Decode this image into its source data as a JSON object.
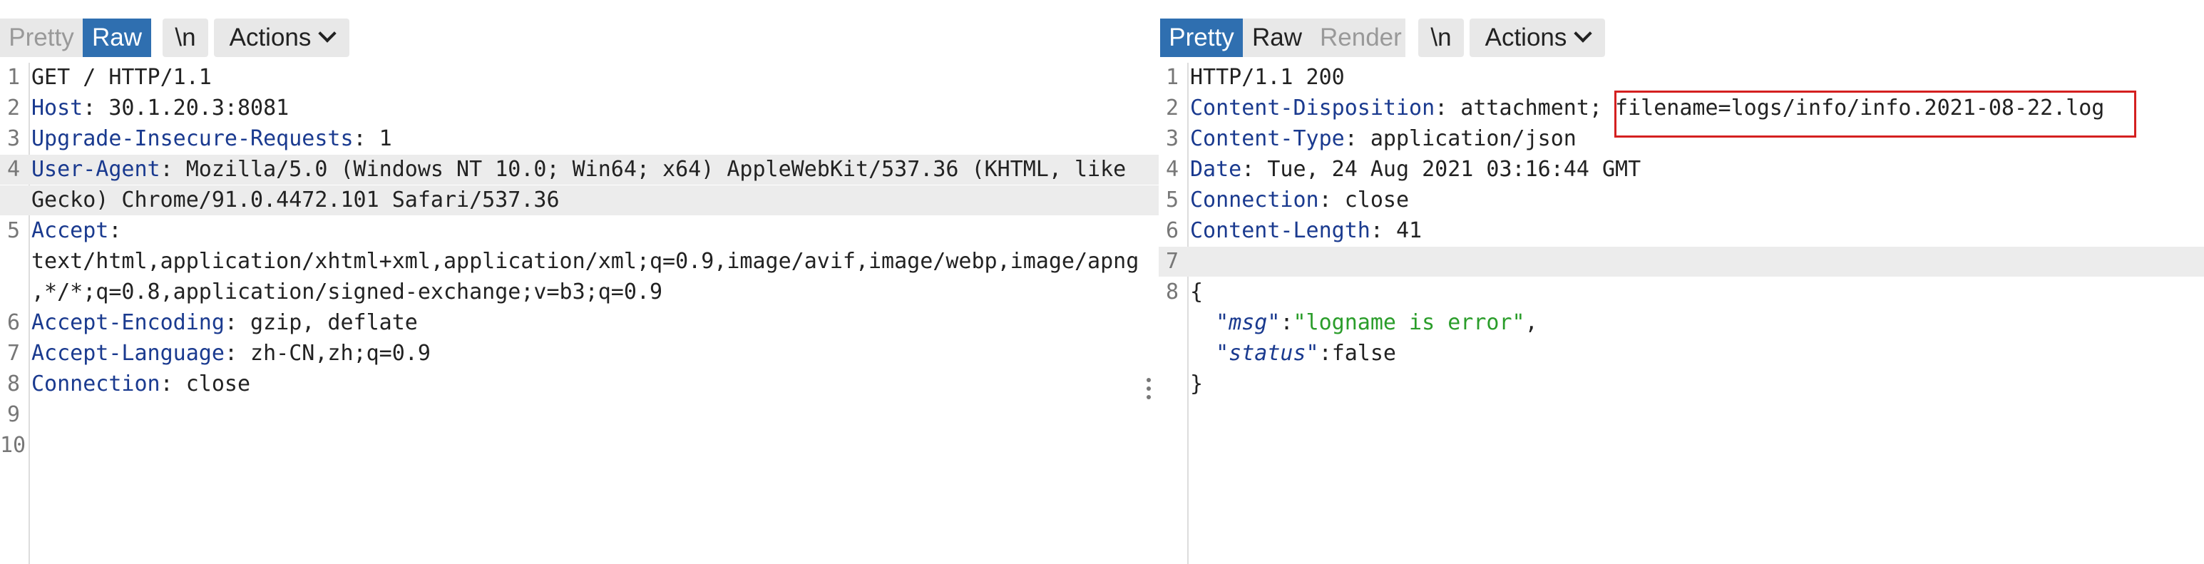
{
  "request": {
    "tabs": [
      {
        "label": "Pretty"
      },
      {
        "label": "Raw",
        "active": true
      },
      {
        "label": "\\n"
      }
    ],
    "actions_label": "Actions",
    "lines": [
      {
        "n": "1",
        "key": "",
        "sep": "",
        "val": "GET / HTTP/1.1"
      },
      {
        "n": "2",
        "key": "Host",
        "sep": ":",
        "val": " 30.1.20.3:8081"
      },
      {
        "n": "3",
        "key": "Upgrade-Insecure-Requests",
        "sep": ":",
        "val": " 1"
      },
      {
        "n": "4",
        "key": "User-Agent",
        "sep": ":",
        "val": " Mozilla/5.0 (Windows NT 10.0; Win64; x64) AppleWebKit/537.36 (KHTML, like"
      },
      {
        "n": "",
        "key": "",
        "sep": "",
        "val": "Gecko) Chrome/91.0.4472.101 Safari/537.36"
      },
      {
        "n": "5",
        "key": "Accept",
        "sep": ":",
        "val": ""
      },
      {
        "n": "",
        "key": "",
        "sep": "",
        "val": "text/html,application/xhtml+xml,application/xml;q=0.9,image/avif,image/webp,image/apng"
      },
      {
        "n": "",
        "key": "",
        "sep": "",
        "val": ",*/*;q=0.8,application/signed-exchange;v=b3;q=0.9"
      },
      {
        "n": "6",
        "key": "Accept-Encoding",
        "sep": ":",
        "val": " gzip, deflate"
      },
      {
        "n": "7",
        "key": "Accept-Language",
        "sep": ":",
        "val": " zh-CN,zh;q=0.9"
      },
      {
        "n": "8",
        "key": "Connection",
        "sep": ":",
        "val": " close"
      },
      {
        "n": "9",
        "key": "",
        "sep": "",
        "val": ""
      },
      {
        "n": "10",
        "key": "",
        "sep": "",
        "val": ""
      }
    ]
  },
  "response": {
    "tabs": [
      {
        "label": "Pretty",
        "active": true
      },
      {
        "label": "Raw"
      },
      {
        "label": "Render"
      },
      {
        "label": "\\n"
      }
    ],
    "actions_label": "Actions",
    "lines": [
      {
        "n": "1",
        "key": "",
        "sep": "",
        "val": "HTTP/1.1 200"
      },
      {
        "n": "2",
        "key": "Content-Disposition",
        "sep": ":",
        "val": " attachment; filename=logs/info/info.2021-08-22.log"
      },
      {
        "n": "3",
        "key": "Content-Type",
        "sep": ":",
        "val": " application/json"
      },
      {
        "n": "4",
        "key": "Date",
        "sep": ":",
        "val": " Tue, 24 Aug 2021 03:16:44 GMT"
      },
      {
        "n": "5",
        "key": "Connection",
        "sep": ":",
        "val": " close"
      },
      {
        "n": "6",
        "key": "Content-Length",
        "sep": ":",
        "val": " 41"
      },
      {
        "n": "7",
        "key": "",
        "sep": "",
        "val": ""
      },
      {
        "n": "8",
        "key": "",
        "sep": "",
        "val": "{"
      },
      {
        "n": "",
        "key": "",
        "sep": "",
        "val": "  \"msg\":\"logname is error\","
      },
      {
        "n": "",
        "key": "",
        "sep": "",
        "val": "  \"status\":false"
      },
      {
        "n": "",
        "key": "",
        "sep": "",
        "val": "}"
      }
    ]
  },
  "colors": {
    "header_key": "#1a3a8f",
    "json_string": "#2a9d2a",
    "active_tab": "#2f6fb0",
    "highlight_box": "#d42020"
  }
}
